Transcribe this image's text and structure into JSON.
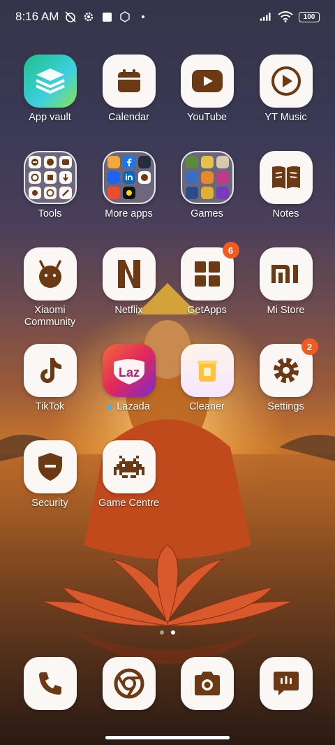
{
  "status": {
    "time": "8:16 AM",
    "battery": "100"
  },
  "apps": [
    {
      "label": "App vault"
    },
    {
      "label": "Calendar"
    },
    {
      "label": "YouTube"
    },
    {
      "label": "YT Music"
    },
    {
      "label": "Tools"
    },
    {
      "label": "More apps"
    },
    {
      "label": "Games"
    },
    {
      "label": "Notes"
    },
    {
      "label": "Xiaomi\nCommunity"
    },
    {
      "label": "Netflix"
    },
    {
      "label": "GetApps",
      "badge": "6"
    },
    {
      "label": "Mi Store"
    },
    {
      "label": "TikTok"
    },
    {
      "label": "Lazada"
    },
    {
      "label": "Cleaner"
    },
    {
      "label": "Settings",
      "badge": "2"
    },
    {
      "label": "Security"
    },
    {
      "label": "Game Centre"
    }
  ],
  "lazada_logo": "Laz",
  "dock": [
    {
      "icon": "phone-icon"
    },
    {
      "icon": "chrome-icon"
    },
    {
      "icon": "camera-icon"
    },
    {
      "icon": "messages-icon"
    }
  ],
  "colors": {
    "icon_brown": "#6b3a14",
    "badge": "#f25a1f"
  }
}
